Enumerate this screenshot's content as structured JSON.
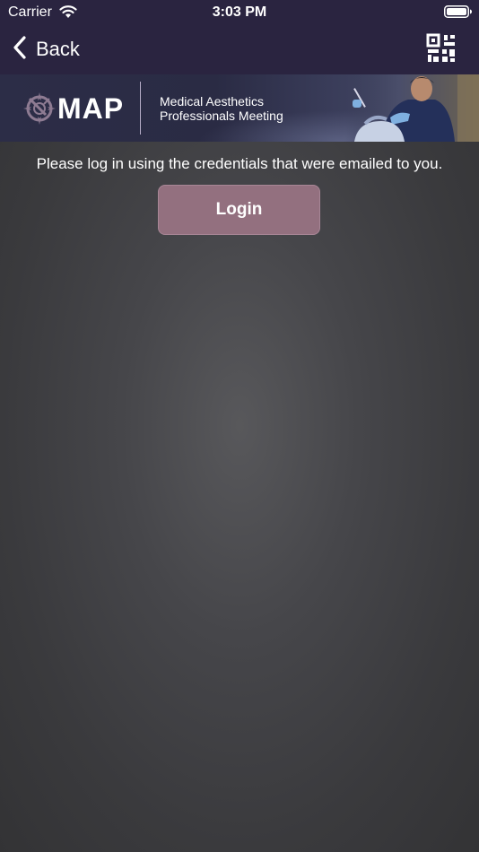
{
  "status_bar": {
    "carrier": "Carrier",
    "time": "3:03 PM",
    "wifi_icon": "wifi-icon",
    "battery_icon": "battery-icon"
  },
  "nav": {
    "back_label": "Back",
    "back_icon": "chevron-left-icon",
    "qr_icon": "qr-code-icon"
  },
  "banner": {
    "logo_text": "MAP",
    "subtitle_line1": "Medical Aesthetics",
    "subtitle_line2": "Professionals Meeting",
    "logo_icon": "compass-icon"
  },
  "main": {
    "message": "Please log in using the credentials that were emailed to you.",
    "login_label": "Login"
  },
  "colors": {
    "nav_background": "#2a2440",
    "content_background": "#3b3b3d",
    "button_background": "#93707f",
    "text": "#ffffff"
  }
}
